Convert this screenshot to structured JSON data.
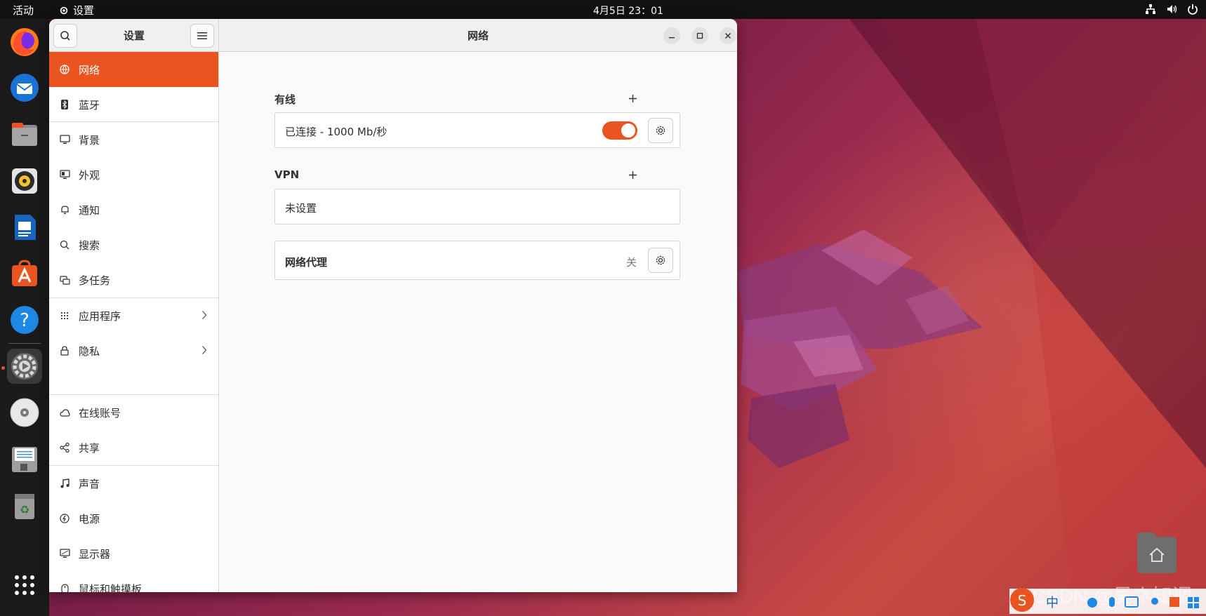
{
  "topbar": {
    "activities": "活动",
    "app_name": "设置",
    "clock": "4月5日  23：01",
    "tray_icons": [
      "network-icon",
      "volume-icon",
      "power-icon"
    ]
  },
  "dock": {
    "items": [
      "firefox-icon",
      "thunderbird-icon",
      "files-icon",
      "rhythmbox-icon",
      "writer-icon",
      "app-center-icon",
      "help-icon",
      "settings-icon",
      "disc-icon",
      "save-drive-icon",
      "trash-icon"
    ],
    "show_apps_icon": "grid-icon",
    "active_item": "settings-icon"
  },
  "window": {
    "sidebar_title": "设置",
    "content_title": "网络"
  },
  "sidebar": {
    "items": [
      {
        "label": "网络",
        "icon": "globe-icon",
        "selected": true
      },
      {
        "label": "蓝牙",
        "icon": "bluetooth-icon"
      },
      {
        "label": "背景",
        "icon": "monitor-icon"
      },
      {
        "label": "外观",
        "icon": "appearance-icon"
      },
      {
        "label": "通知",
        "icon": "bell-icon"
      },
      {
        "label": "搜索",
        "icon": "search-icon"
      },
      {
        "label": "多任务",
        "icon": "multitask-icon"
      },
      {
        "label": "应用程序",
        "icon": "apps-grid-icon",
        "chevron": true
      },
      {
        "label": "隐私",
        "icon": "lock-icon",
        "chevron": true
      },
      {
        "label": "在线账号",
        "icon": "cloud-icon"
      },
      {
        "label": "共享",
        "icon": "share-icon"
      },
      {
        "label": "声音",
        "icon": "music-note-icon"
      },
      {
        "label": "电源",
        "icon": "power-icon"
      },
      {
        "label": "显示器",
        "icon": "display-icon"
      },
      {
        "label": "鼠标和触摸板",
        "icon": "mouse-icon"
      }
    ]
  },
  "network": {
    "wired": {
      "label": "有线",
      "status": "已连接 - 1000 Mb/秒",
      "enabled": true
    },
    "vpn": {
      "label": "VPN",
      "status": "未设置"
    },
    "proxy": {
      "label": "网络代理",
      "state": "关"
    }
  },
  "overlay": {
    "watermark": "CSDN @吴ネ知调",
    "ime_label": "中"
  },
  "colors": {
    "accent": "#e95420",
    "topbar": "#111111",
    "dock": "#1a1a1a"
  }
}
